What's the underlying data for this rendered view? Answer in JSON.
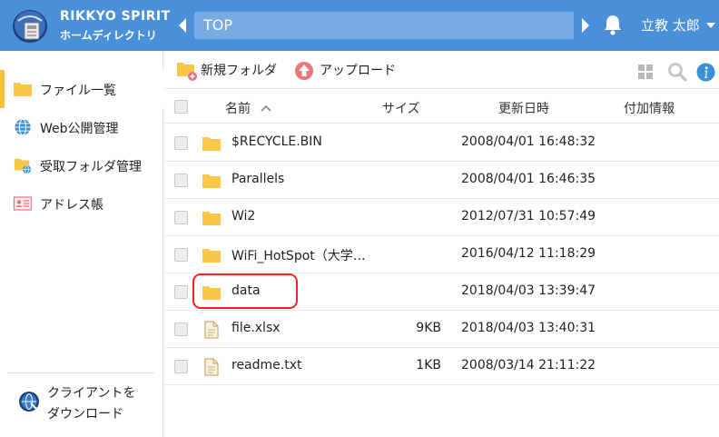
{
  "header": {
    "logo_line1": "RIKKYO SPIRIT",
    "logo_line2": "ホームディレクトリ",
    "path": "TOP",
    "user_name": "立教 太郎",
    "bg_color": "#4a90d9"
  },
  "sidebar": {
    "items": [
      {
        "label": "ファイル一覧",
        "icon": "folder-icon",
        "active": true
      },
      {
        "label": "Web公開管理",
        "icon": "globe-icon",
        "active": false
      },
      {
        "label": "受取フォルダ管理",
        "icon": "shared-folder-icon",
        "active": false
      },
      {
        "label": "アドレス帳",
        "icon": "address-book-icon",
        "active": false
      }
    ],
    "client_download": {
      "line1": "クライアントを",
      "line2": "ダウンロード",
      "icon": "globe-download-icon"
    },
    "active_color": "#f5c23d"
  },
  "toolbar": {
    "new_folder_label": "新規フォルダ",
    "upload_label": "アップロード"
  },
  "table": {
    "columns": {
      "name": "名前",
      "size": "サイズ",
      "modified": "更新日時",
      "info": "付加情報"
    },
    "rows": [
      {
        "type": "folder",
        "name": "$RECYCLE.BIN",
        "size": "",
        "modified": "2008/04/01 16:48:32"
      },
      {
        "type": "folder",
        "name": "Parallels",
        "size": "",
        "modified": "2008/04/01 16:46:35"
      },
      {
        "type": "folder",
        "name": "Wi2",
        "size": "",
        "modified": "2012/07/31 10:57:49"
      },
      {
        "type": "folder",
        "name": "WiFi_HotSpot（大学…",
        "size": "",
        "modified": "2016/04/12 11:18:29"
      },
      {
        "type": "folder",
        "name": "data",
        "size": "",
        "modified": "2018/04/03 13:39:47",
        "highlighted": true
      },
      {
        "type": "file",
        "name": "file.xlsx",
        "size": "9KB",
        "modified": "2018/04/03 13:40:31"
      },
      {
        "type": "file",
        "name": "readme.txt",
        "size": "1KB",
        "modified": "2008/03/14 21:11:22"
      }
    ]
  },
  "colors": {
    "folder": "#f9c846",
    "highlight": "#ff2020",
    "upload": "#e8757a"
  }
}
